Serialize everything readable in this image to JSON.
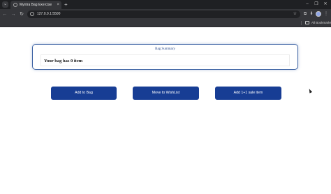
{
  "browser": {
    "tab_title": "Myntra Bag Exercise",
    "url": "127.0.0.1:5500",
    "bookmarks_label": "All Bookmarks"
  },
  "summary": {
    "title": "Bag Summary",
    "text": "Your bag has 0 item"
  },
  "buttons": {
    "add": "Add to Bag",
    "wishlist": "Move to WishList",
    "sale": "Add 1+1 sale item"
  },
  "colors": {
    "button_bg": "#173d94",
    "summary_border": "#3c62a3"
  },
  "icons": [
    "tab-search-icon",
    "close-icon",
    "new-tab-icon",
    "back-icon",
    "forward-icon",
    "reload-icon",
    "star-icon",
    "extensions-icon",
    "download-icon",
    "menu-icon",
    "folder-icon"
  ]
}
